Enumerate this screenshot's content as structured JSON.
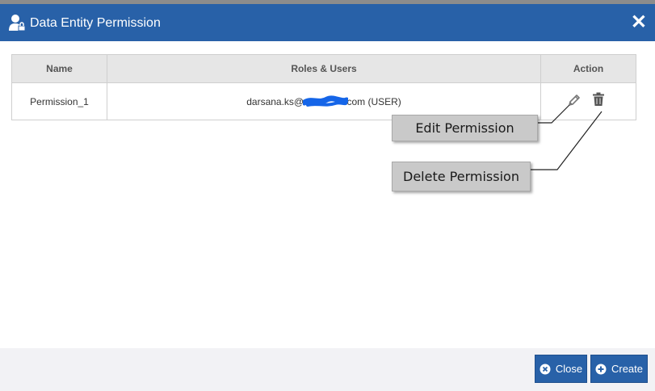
{
  "dialog": {
    "title": "Data Entity Permission",
    "close_glyph": "✕",
    "header_color": "#2861a8"
  },
  "table": {
    "columns": [
      "Name",
      "Roles & Users",
      "Action"
    ],
    "rows": [
      {
        "name": "Permission_1",
        "roles_users_prefix": "darsana.ks@",
        "roles_users_suffix": ".com (USER)"
      }
    ]
  },
  "callouts": {
    "edit": "Edit Permission",
    "delete": "Delete Permission"
  },
  "footer": {
    "close_label": "Close",
    "create_label": "Create"
  },
  "icons": [
    "user-lock-icon",
    "close-icon",
    "pencil-icon",
    "trash-icon",
    "x-circle-icon",
    "plus-circle-icon"
  ]
}
